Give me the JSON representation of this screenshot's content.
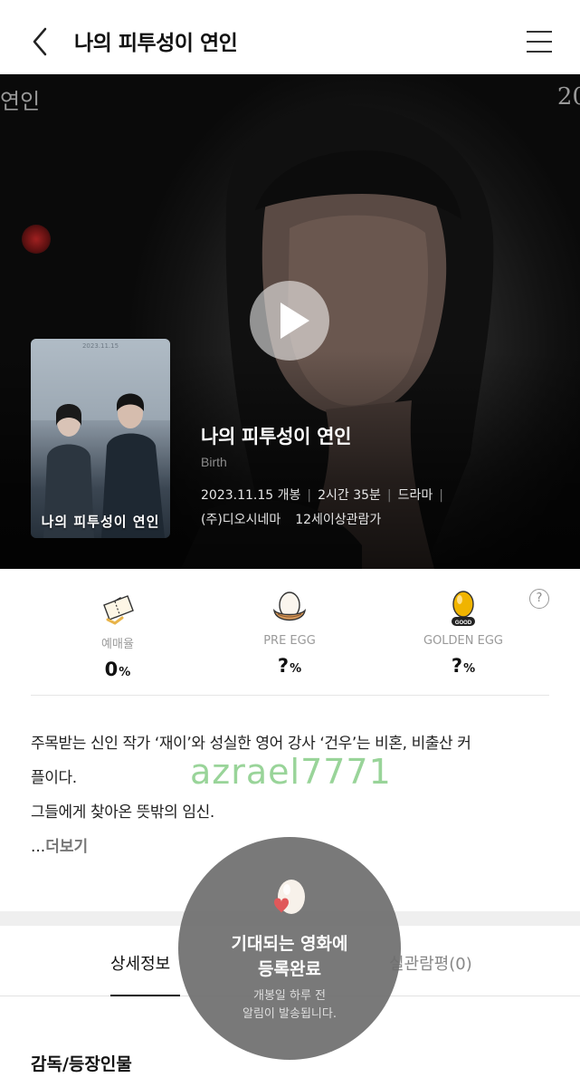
{
  "header": {
    "title": "나의 피투성이 연인"
  },
  "hero": {
    "side_text_left": "연인",
    "side_text_right": "20",
    "poster": {
      "date": "2023.11.15",
      "title": "나의 피투성이 연인"
    },
    "movie_title": "나의 피투성이 연인",
    "english_title": "Birth",
    "release": "2023.11.15 개봉",
    "runtime": "2시간 35분",
    "genre": "드라마",
    "distributor": "(주)디오시네마",
    "rating": "12세이상관람가"
  },
  "stats": {
    "items": [
      {
        "label": "예매율",
        "value": "0",
        "unit": "%"
      },
      {
        "label": "PRE EGG",
        "value": "?",
        "unit": "%"
      },
      {
        "label": "GOLDEN EGG",
        "value": "?",
        "unit": "%",
        "badge": "GOOD"
      }
    ],
    "help": "?"
  },
  "synopsis": {
    "line1": "주목받는 신인 작가 ‘재이’와 성실한 영어 강사 ‘건우’는 비혼, 비출산 커",
    "line2": "플이다.",
    "line3": "그들에게 찾아온 뜻밖의 임신.",
    "ellipsis": "...",
    "more": "더보기"
  },
  "watermark": "azrael7771",
  "tabs": {
    "details": "상세정보",
    "reviews": "실관람평(0)"
  },
  "section": {
    "title": "감독/등장인물"
  },
  "toast": {
    "title_line1": "기대되는 영화에",
    "title_line2": "등록완료",
    "sub_line1": "개봉일 하루 전",
    "sub_line2": "알림이 발송됩니다."
  },
  "colors": {
    "accent_green_watermark": "#8fd08f",
    "egg_gold": "#f0b400",
    "heart": "#e0585a"
  },
  "icons": [
    "back-arrow-icon",
    "hamburger-menu-icon",
    "play-icon",
    "ticket-icon",
    "egg-nest-icon",
    "golden-egg-icon",
    "help-icon",
    "heart-egg-icon"
  ]
}
